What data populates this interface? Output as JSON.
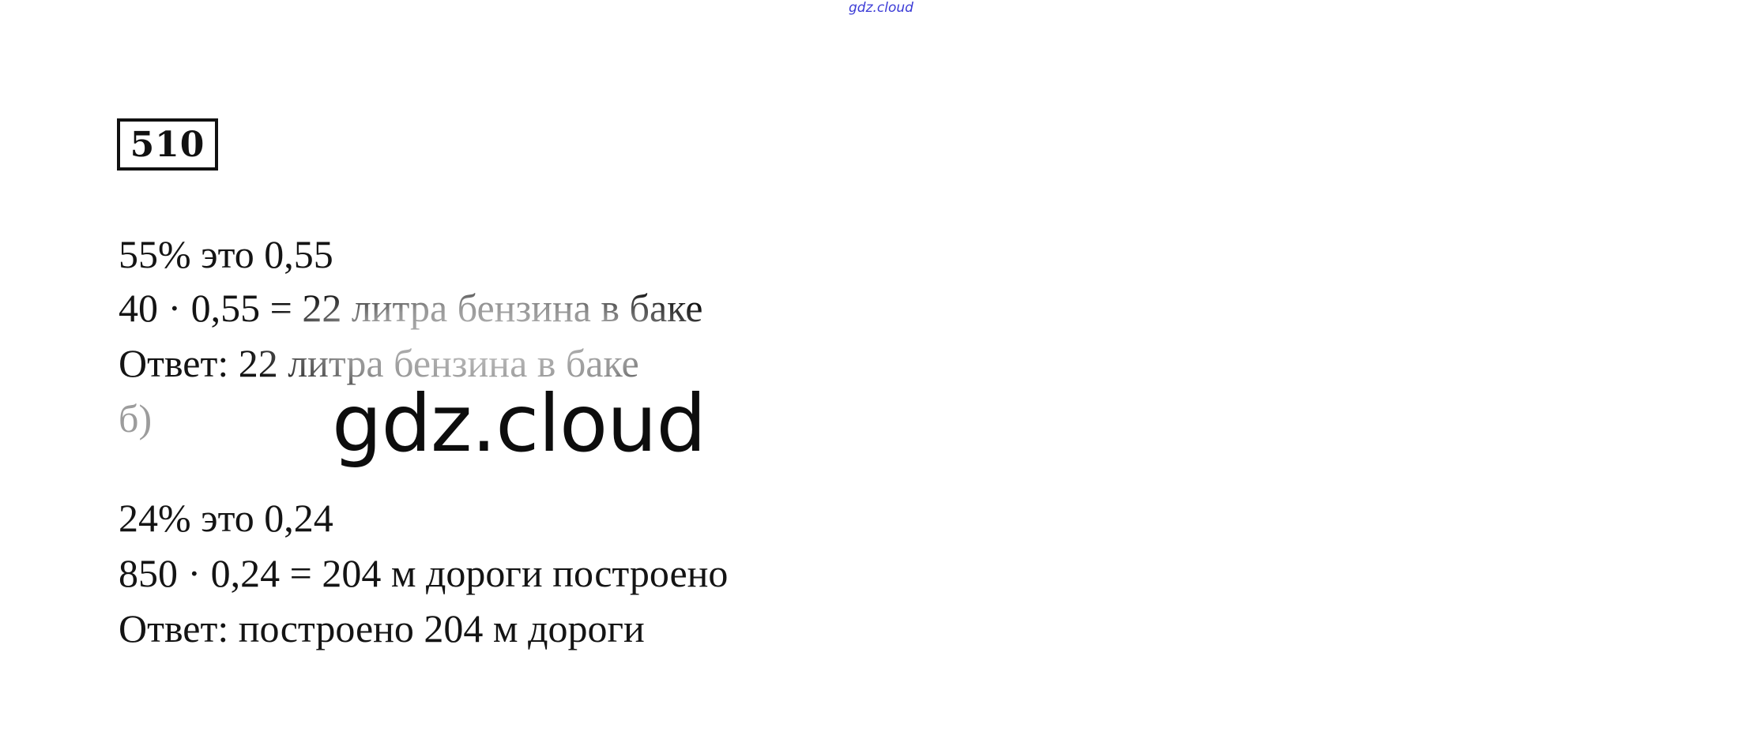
{
  "watermark_top": "gdz.cloud",
  "problem_number": "510",
  "part_a": {
    "line1": "55% это 0,55",
    "line2": "40 · 0,55 = 22 литра бензина в баке",
    "answer": "Ответ: 22 литра бензина в баке"
  },
  "part_b": {
    "label": "б)",
    "line1": "24% это 0,24",
    "line2": "850 · 0,24 = 204 м дороги построено",
    "answer": "Ответ: построено 204 м дороги"
  },
  "watermark_center": "gdz.cloud"
}
